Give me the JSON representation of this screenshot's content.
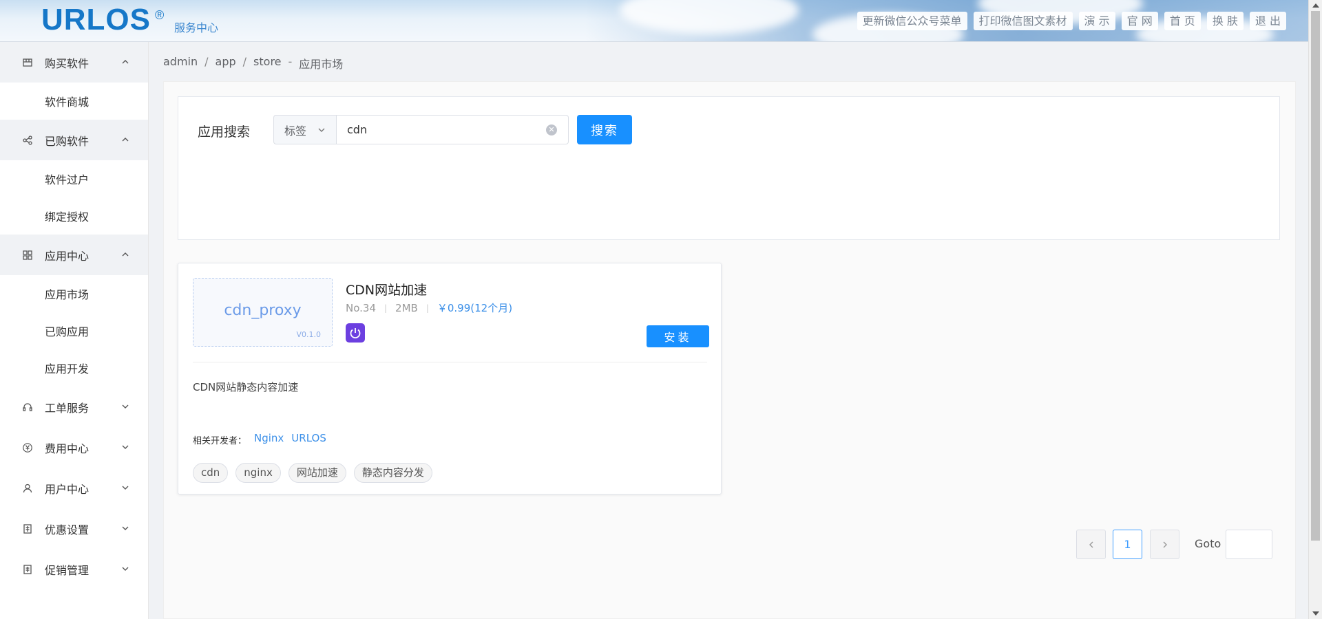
{
  "header": {
    "logo": "URLOS",
    "logo_mark": "®",
    "subtitle": "服务中心",
    "buttons": [
      "更新微信公众号菜单",
      "打印微信图文素材",
      "演 示",
      "官 网",
      "首 页",
      "换 肤",
      "退 出"
    ]
  },
  "sidebar": {
    "groups": [
      {
        "label": "购买软件",
        "icon": "store-icon",
        "expanded": true,
        "items": [
          "软件商城"
        ]
      },
      {
        "label": "已购软件",
        "icon": "share-icon",
        "expanded": true,
        "items": [
          "软件过户",
          "绑定授权"
        ]
      },
      {
        "label": "应用中心",
        "icon": "grid-icon",
        "expanded": true,
        "items": [
          "应用市场",
          "已购应用",
          "应用开发"
        ]
      },
      {
        "label": "工单服务",
        "icon": "headset-icon",
        "expanded": false
      },
      {
        "label": "费用中心",
        "icon": "yen-icon",
        "expanded": false
      },
      {
        "label": "用户中心",
        "icon": "user-icon",
        "expanded": false
      },
      {
        "label": "优惠设置",
        "icon": "discount-icon",
        "expanded": false
      },
      {
        "label": "促销管理",
        "icon": "promotion-icon",
        "expanded": false
      }
    ]
  },
  "breadcrumb": {
    "p1": "admin",
    "s1": "/",
    "p2": "app",
    "s2": "/",
    "p3": "store",
    "s3": "-",
    "p4": "应用市场"
  },
  "search": {
    "label": "应用搜索",
    "select_value": "标签",
    "query": "cdn",
    "button": "搜索"
  },
  "app": {
    "thumb_name": "cdn_proxy",
    "version": "V0.1.0",
    "title": "CDN网站加速",
    "number": "No.34",
    "size": "2MB",
    "price": "￥0.99(12个月)",
    "install": "安装",
    "description": "CDN网站静态内容加速",
    "developer_label": "相关开发者：",
    "developers": [
      "Nginx",
      "URLOS"
    ],
    "tags": [
      "cdn",
      "nginx",
      "网站加速",
      "静态内容分发"
    ]
  },
  "pagination": {
    "current": "1",
    "goto_label": "Goto"
  },
  "colors": {
    "primary": "#1890ff",
    "logo": "#1677c8",
    "link": "#3b8fe8",
    "app_icon": "#6c3fe0"
  }
}
